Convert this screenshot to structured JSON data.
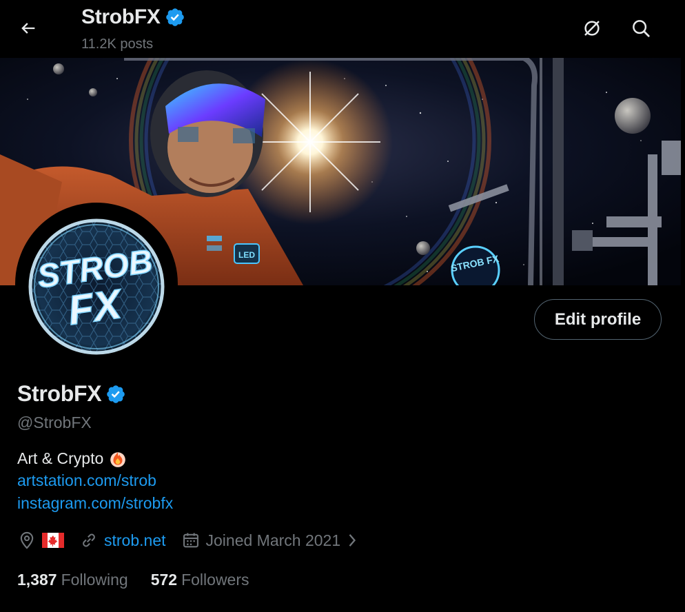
{
  "header": {
    "title": "StrobFX",
    "posts_count": "11.2K posts"
  },
  "banner": {
    "badge_text": "STROB FX",
    "chest_label": "LED"
  },
  "avatar": {
    "line1": "STROB",
    "line2": "FX"
  },
  "profile": {
    "edit_label": "Edit profile",
    "display_name": "StrobFX",
    "handle": "@StrobFX",
    "bio_text": "Art & Crypto",
    "bio_links": [
      "artstation.com/strob",
      "instagram.com/strobfx"
    ],
    "website": "strob.net",
    "joined": "Joined March 2021"
  },
  "stats": {
    "following_count": "1,387",
    "following_label": "Following",
    "followers_count": "572",
    "followers_label": "Followers"
  },
  "icons": {
    "back": "arrow-left-icon",
    "verified": "verified-badge-icon",
    "no_signal": "no-signal-icon",
    "search": "search-icon",
    "location": "location-pin-icon",
    "flag": "canada-flag-icon",
    "link": "link-icon",
    "calendar": "calendar-icon",
    "chevron": "chevron-right-icon",
    "fire": "fire-icon"
  },
  "colors": {
    "background": "#000000",
    "text_primary": "#e7e9ea",
    "text_secondary": "#71767b",
    "accent": "#1d9bf0",
    "border": "#536471"
  }
}
